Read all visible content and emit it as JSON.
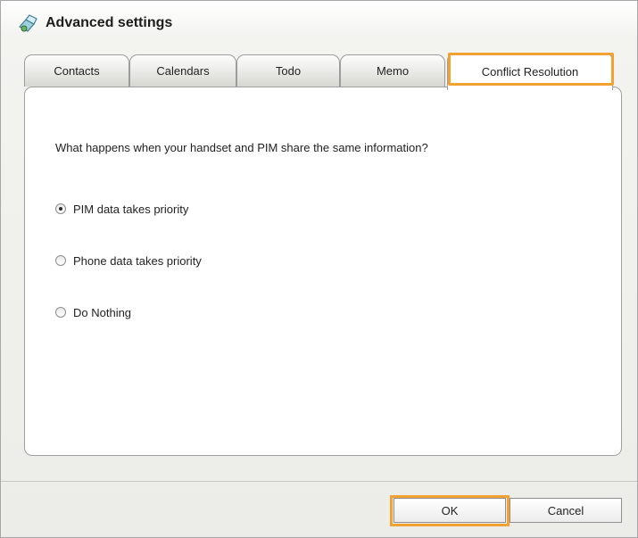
{
  "window": {
    "title": "Advanced settings"
  },
  "tabs": [
    {
      "label": "Contacts",
      "active": false
    },
    {
      "label": "Calendars",
      "active": false
    },
    {
      "label": "Todo",
      "active": false
    },
    {
      "label": "Memo",
      "active": false
    },
    {
      "label": "Conflict Resolution",
      "active": true
    }
  ],
  "conflict": {
    "question": "What happens when your handset and PIM share the same information?",
    "options": [
      {
        "label": "PIM data takes priority",
        "selected": true
      },
      {
        "label": "Phone data takes priority",
        "selected": false
      },
      {
        "label": "Do Nothing",
        "selected": false
      }
    ]
  },
  "buttons": {
    "ok": "OK",
    "cancel": "Cancel"
  },
  "colors": {
    "highlight": "#f2a233"
  }
}
